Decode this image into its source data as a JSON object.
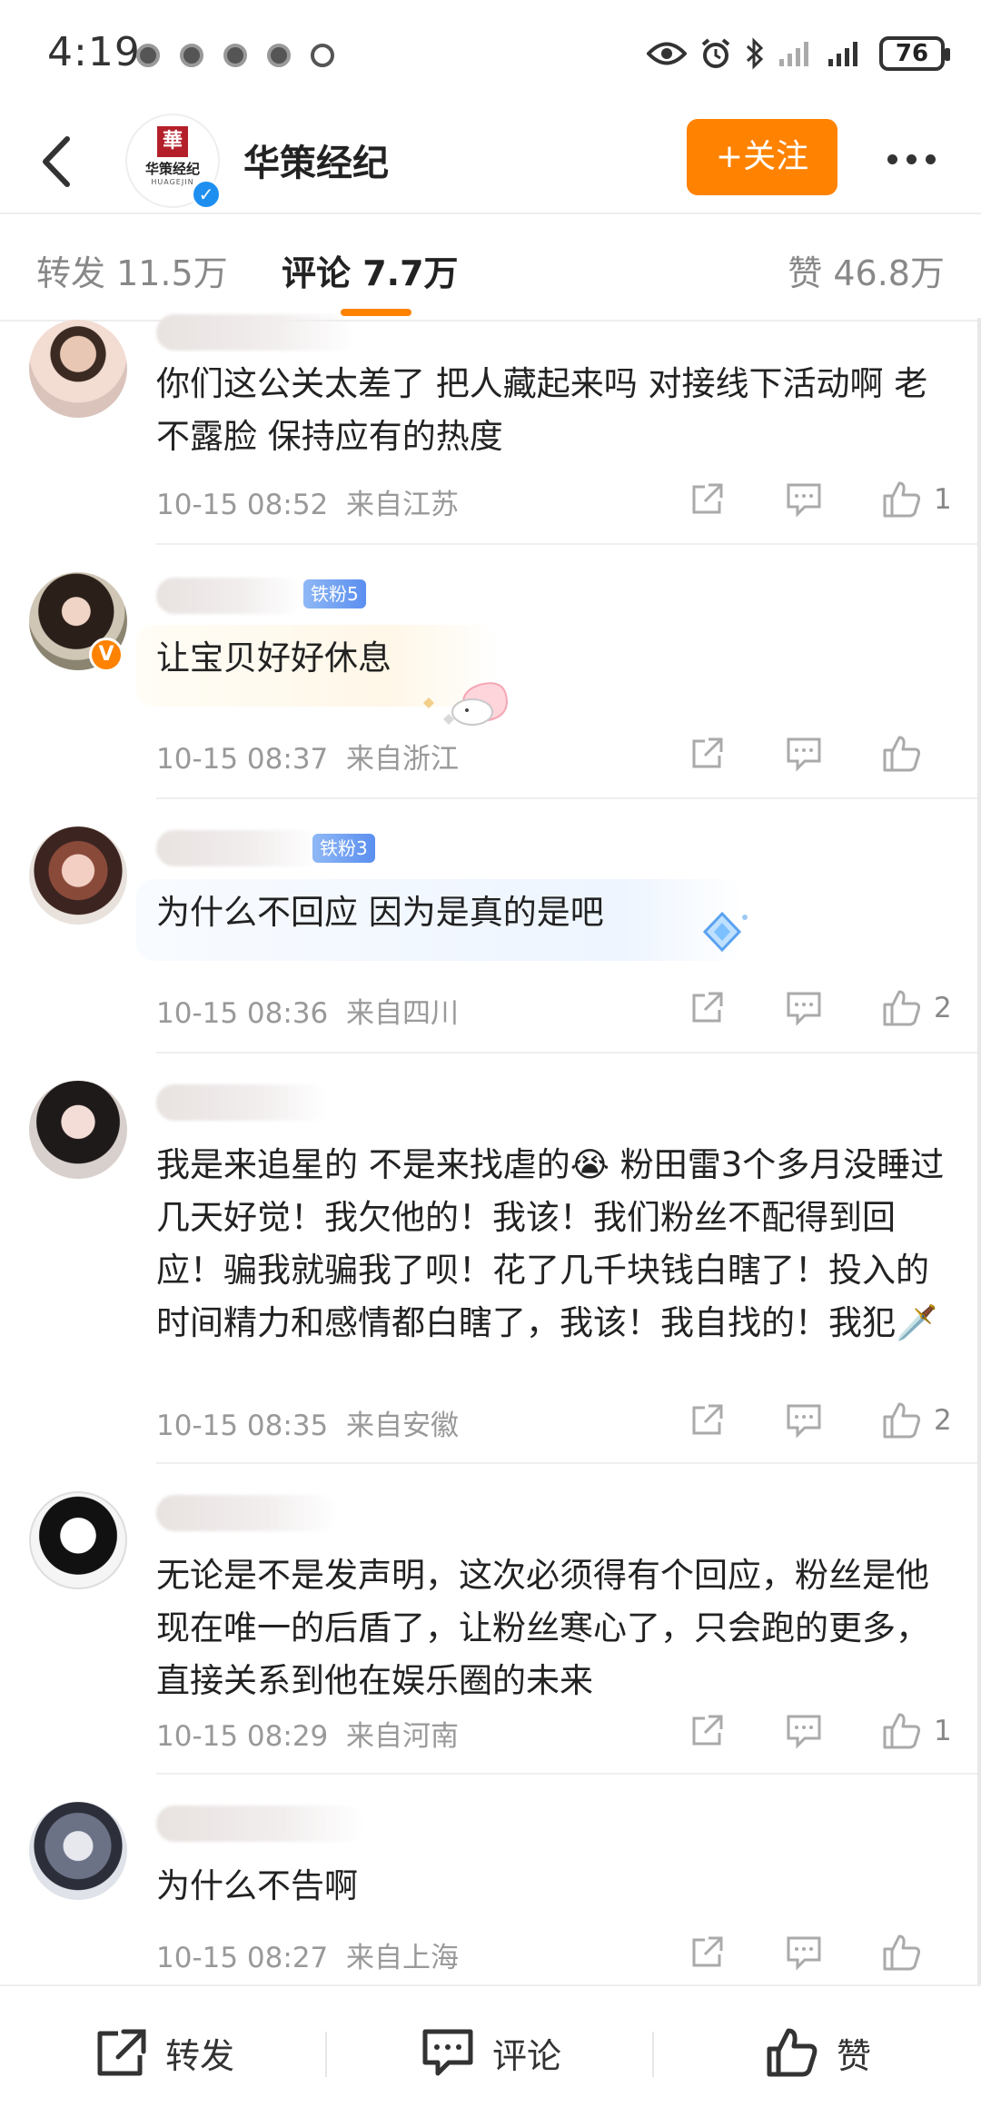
{
  "status_bar": {
    "time": "4:19",
    "battery": "76",
    "icons": [
      "eye-icon",
      "alarm-icon",
      "bluetooth-icon",
      "signal-icon",
      "signal-icon"
    ]
  },
  "header": {
    "account_name": "华策经纪",
    "logo_mark": "華",
    "logo_text": "华策经纪",
    "logo_sub": "HUAGEJIN",
    "follow_label": "+关注",
    "verified": "✓"
  },
  "tabs": {
    "repost": "转发 11.5万",
    "comments": "评论 7.7万",
    "likes": "赞 46.8万"
  },
  "comments": [
    {
      "text": "你们这公关太差了 把人藏起来吗 对接线下活动啊 老不露脸 保持应有的热度",
      "time": "10-15 08:52",
      "location": "来自江苏",
      "likes": "1"
    },
    {
      "fan_badge": "铁粉5",
      "avatar_badge": "V",
      "text": "让宝贝好好休息",
      "time": "10-15 08:37",
      "location": "来自浙江",
      "likes": ""
    },
    {
      "fan_badge": "铁粉3",
      "text": "为什么不回应 因为是真的是吧",
      "time": "10-15 08:36",
      "location": "来自四川",
      "likes": "2"
    },
    {
      "text": "我是来追星的 不是来找虐的😭 粉田雷3个多月没睡过几天好觉！我欠他的！我该！我们粉丝不配得到回应！骗我就骗我了呗！花了几千块钱白瞎了！投入的时间精力和感情都白瞎了，我该！我自找的！我犯🗡️",
      "time": "10-15 08:35",
      "location": "来自安徽",
      "likes": "2"
    },
    {
      "text": "无论是不是发声明，这次必须得有个回应，粉丝是他现在唯一的后盾了，让粉丝寒心了，只会跑的更多，直接关系到他在娱乐圈的未来",
      "time": "10-15 08:29",
      "location": "来自河南",
      "likes": "1"
    },
    {
      "text": "为什么不告啊",
      "time": "10-15 08:27",
      "location": "来自上海",
      "likes": ""
    }
  ],
  "bottom_bar": {
    "repost": "转发",
    "comment": "评论",
    "like": "赞"
  },
  "colors": {
    "accent": "#ff8200",
    "verified_blue": "#1e8ff0",
    "meta_gray": "#999999"
  }
}
